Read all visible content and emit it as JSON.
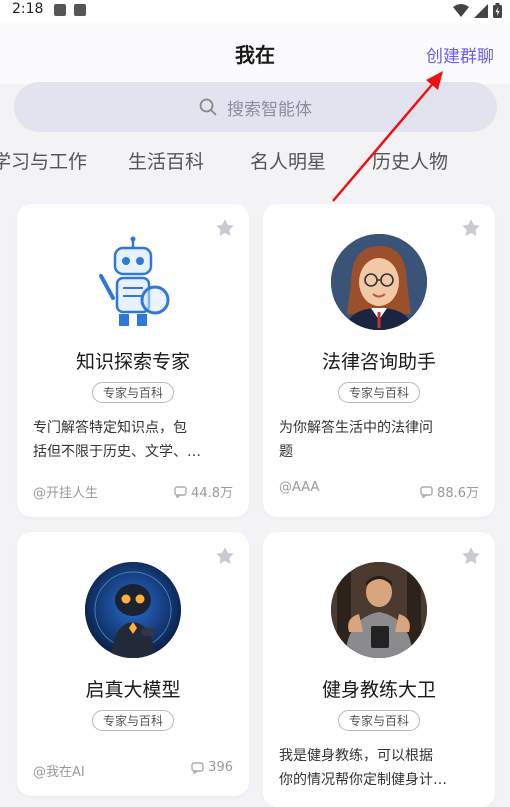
{
  "status": {
    "time": "2:18"
  },
  "header": {
    "title": "我在",
    "create_group": "创建群聊"
  },
  "search": {
    "placeholder": "搜索智能体"
  },
  "tabs": [
    "学习与工作",
    "生活百科",
    "名人明星",
    "历史人物"
  ],
  "cards": [
    {
      "name": "知识探索专家",
      "tag": "专家与百科",
      "desc_line1": "专门解答特定知识点，包",
      "desc_line2": "括但不限于历史、文学、…",
      "author": "@开挂人生",
      "count": "44.8万",
      "avatar": "robot-avatar"
    },
    {
      "name": "法律咨询助手",
      "tag": "专家与百科",
      "desc_line1": "为你解答生活中的法律问",
      "desc_line2": "题",
      "author": "@AAA",
      "count": "88.6万",
      "avatar": "lawyer-avatar"
    },
    {
      "name": "启真大模型",
      "tag": "专家与百科",
      "desc_line1": "",
      "desc_line2": "",
      "author": "@我在AI",
      "count": "396",
      "avatar": "ai-robot-avatar"
    },
    {
      "name": "健身教练大卫",
      "tag": "专家与百科",
      "desc_line1": "我是健身教练，可以根据",
      "desc_line2": "你的情况帮你定制健身计…",
      "author": "",
      "count": "",
      "avatar": "fitness-coach-avatar"
    }
  ],
  "colors": {
    "accent": "#6a5ee8",
    "background": "#f3f3f6",
    "search_bg": "#e3e3ef"
  }
}
